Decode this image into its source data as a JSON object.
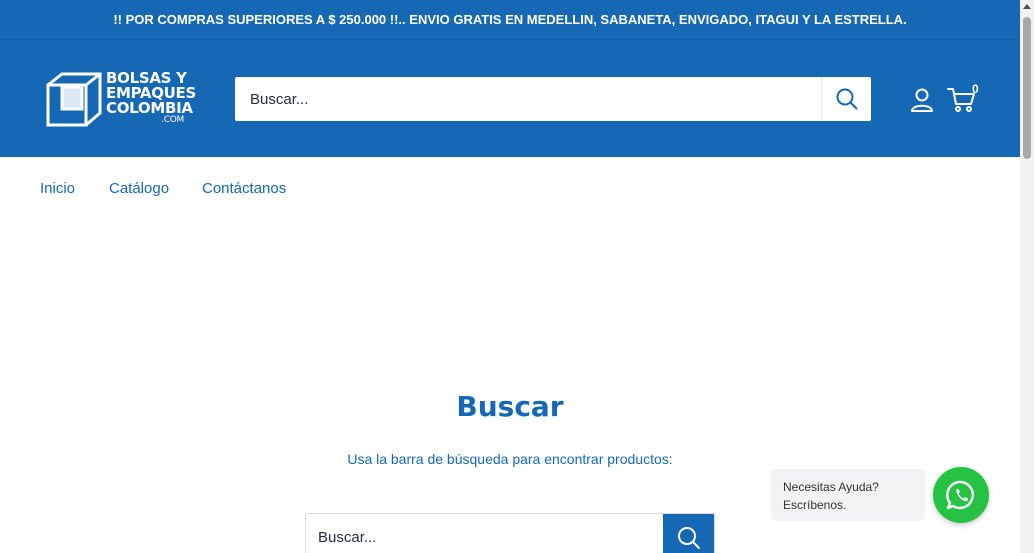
{
  "announcement": {
    "text": "!! POR COMPRAS SUPERIORES A $ 250.000 !!.. ENVIO GRATIS EN MEDELLIN, SABANETA, ENVIGADO, ITAGUI Y LA ESTRELLA."
  },
  "header": {
    "logo": {
      "line1": "BOLSAS Y",
      "line2": "EMPAQUES",
      "line3": "COLOMBIA",
      "line4": ".COM"
    },
    "search": {
      "placeholder": "Buscar..."
    },
    "cart_count": "0"
  },
  "nav": {
    "items": [
      {
        "label": "Inicio"
      },
      {
        "label": "Catálogo"
      },
      {
        "label": "Contáctanos"
      }
    ]
  },
  "main": {
    "title": "Buscar",
    "subtitle": "Usa la barra de búsqueda para encontrar productos:",
    "search": {
      "placeholder": "Buscar..."
    }
  },
  "whatsapp": {
    "line1": "Necesitas Ayuda?",
    "line2": "Escríbenos."
  },
  "colors": {
    "brand": "#1668b4",
    "whatsapp": "#25c244"
  },
  "icons": {
    "search": "search-icon",
    "account": "user-icon",
    "cart": "cart-icon",
    "whatsapp": "whatsapp-icon"
  }
}
